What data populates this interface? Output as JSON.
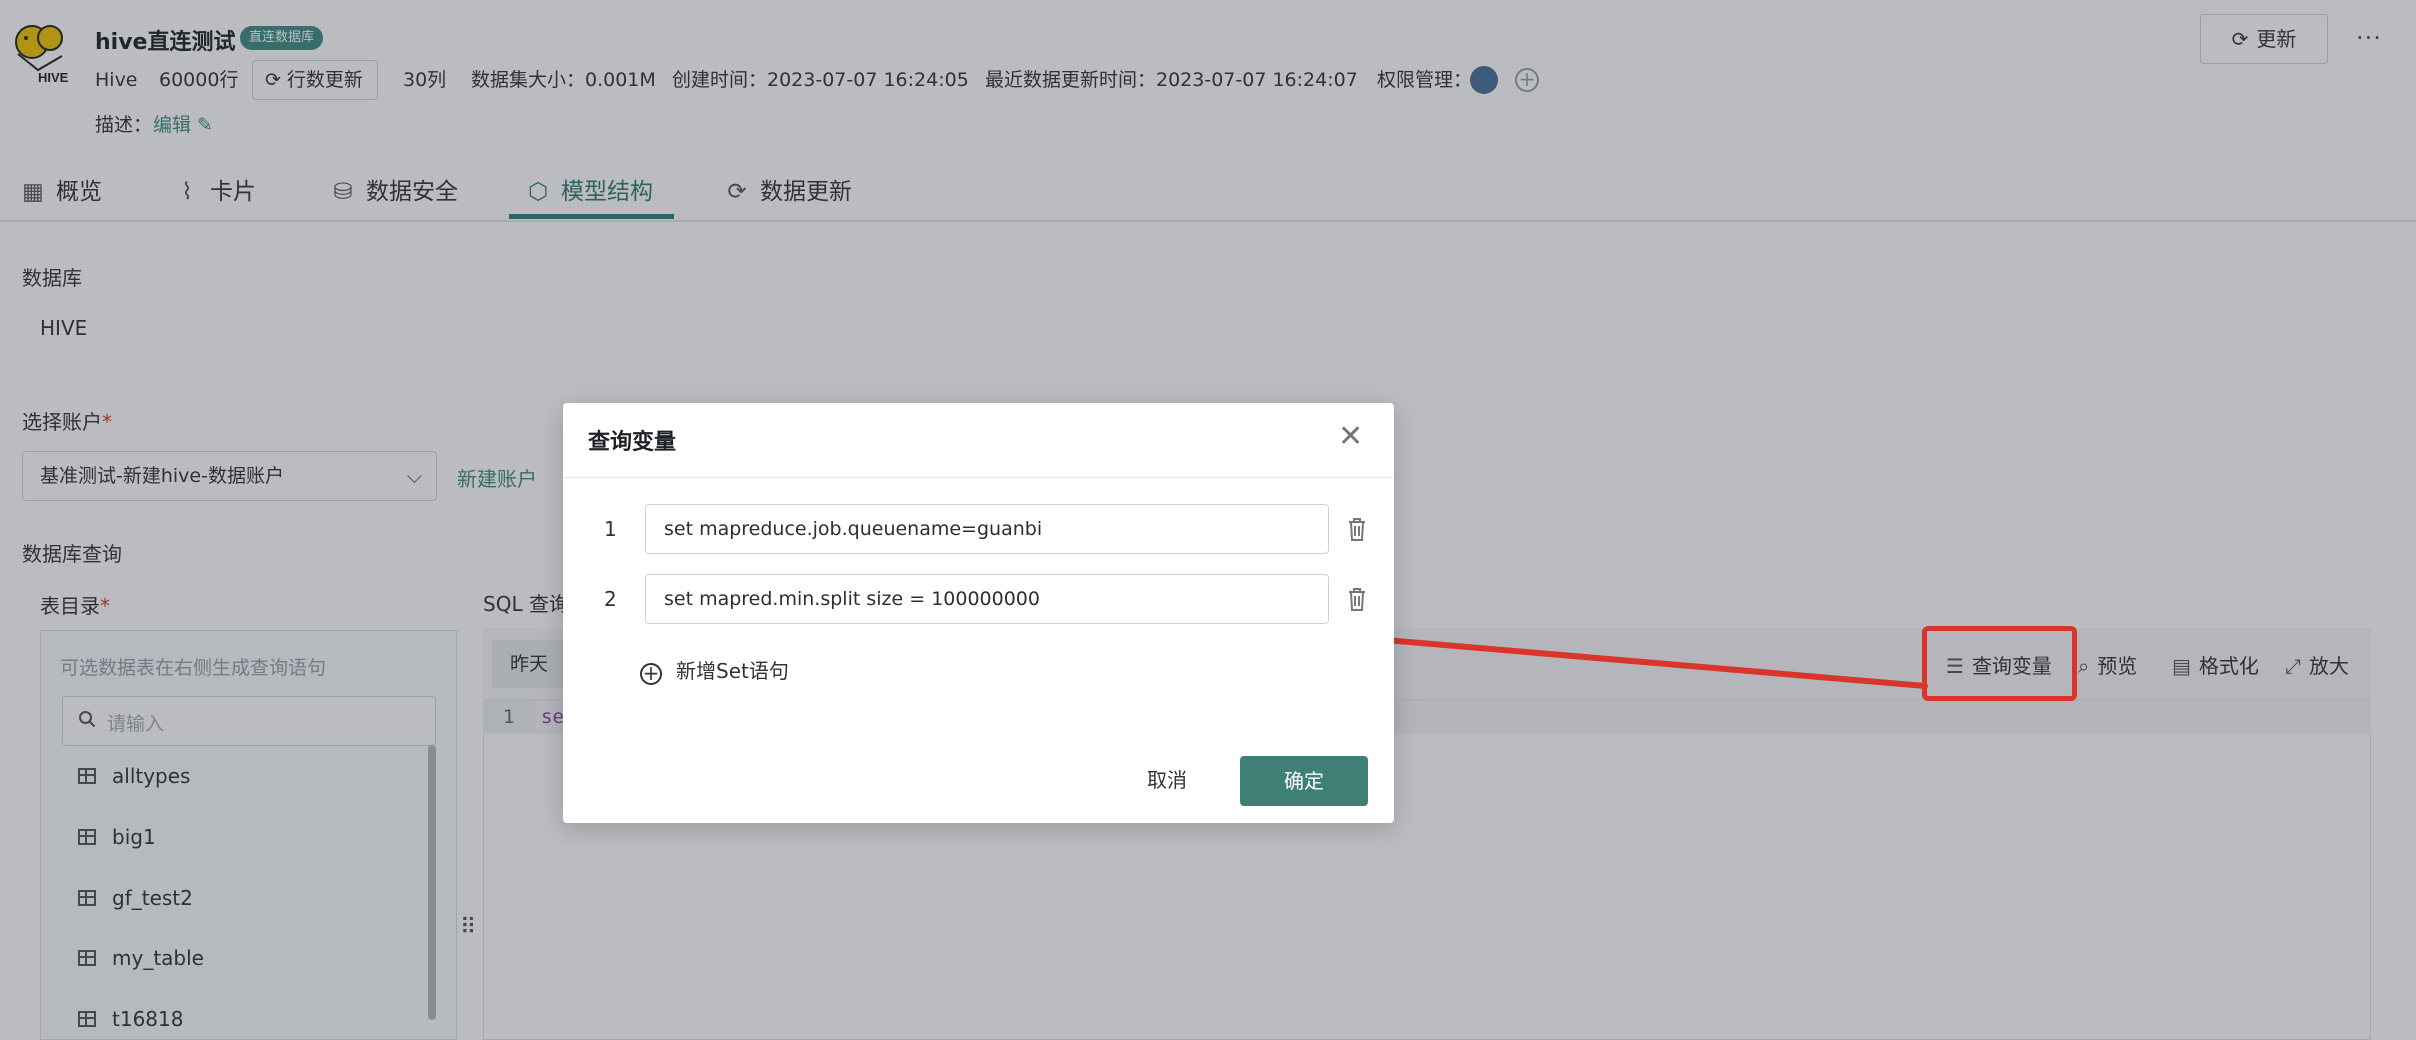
{
  "header": {
    "title": "hive直连测试",
    "badge": "直连数据库",
    "db_type": "Hive",
    "rows": "60000行",
    "row_refresh": "行数更新",
    "cols": "30列",
    "size": "数据集大小：0.001M",
    "created": "创建时间：2023-07-07 16:24:05",
    "updated": "最近数据更新时间：2023-07-07 16:24:07",
    "perm_label": "权限管理：",
    "desc_label": "描述：",
    "desc_edit": "编辑",
    "update_btn": "更新",
    "more": "···"
  },
  "tabs": [
    {
      "label": "概览",
      "icon": "table-icon"
    },
    {
      "label": "卡片",
      "icon": "chart-icon"
    },
    {
      "label": "数据安全",
      "icon": "database-icon"
    },
    {
      "label": "模型结构",
      "icon": "cube-icon",
      "active": true
    },
    {
      "label": "数据更新",
      "icon": "refresh-icon"
    }
  ],
  "content": {
    "db_label": "数据库",
    "db_value": "HIVE",
    "account_label": "选择账户",
    "account_value": "基准测试-新建hive-数据账户",
    "new_account": "新建账户",
    "query_label": "数据库查询",
    "table_dir_label": "表目录",
    "sql_label": "SQL 查询",
    "tree_hint": "可选数据表在右侧生成查询语句",
    "search_placeholder": "请输入",
    "tables": [
      "alltypes",
      "big1",
      "gf_test2",
      "my_table",
      "t16818"
    ],
    "yesterday": "昨天",
    "tool_query_var": "查询变量",
    "tool_preview": "预览",
    "tool_format": "格式化",
    "tool_zoom": "放大",
    "line_no": "1",
    "code": "se"
  },
  "modal": {
    "title": "查询变量",
    "vars": [
      {
        "num": "1",
        "value": "set mapreduce.job.queuename=guanbi"
      },
      {
        "num": "2",
        "value": "set mapred.min.split size = 100000000"
      }
    ],
    "add_set": "新增Set语句",
    "cancel": "取消",
    "ok": "确定"
  },
  "colors": {
    "accent": "#3e8c82",
    "annotation": "#d9352b"
  }
}
